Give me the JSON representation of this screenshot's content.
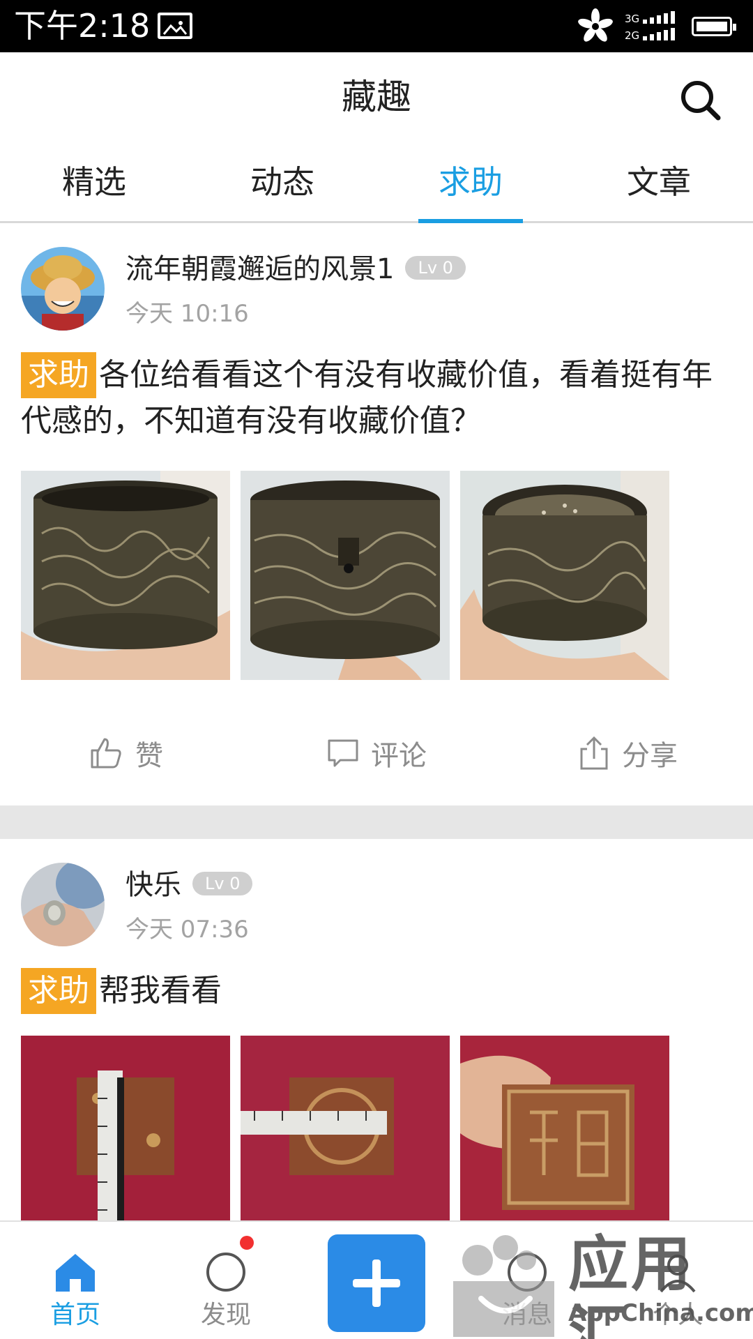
{
  "status_bar": {
    "time": "下午2:18",
    "network_top": "3G",
    "network_bottom": "2G"
  },
  "header": {
    "title": "藏趣",
    "search_icon": "search-icon"
  },
  "tabs": [
    {
      "label": "精选",
      "active": false
    },
    {
      "label": "动态",
      "active": false
    },
    {
      "label": "求助",
      "active": true
    },
    {
      "label": "文章",
      "active": false
    }
  ],
  "posts": [
    {
      "username": "流年朝霞邂逅的风景1",
      "level": "Lv 0",
      "time": "今天 10:16",
      "tag": "求助",
      "text": "各位给看看这个有没有收藏价值，看着挺有年代感的，不知道有没有收藏价值？"
    },
    {
      "username": "快乐",
      "level": "Lv 0",
      "time": "今天 07:36",
      "tag": "求助",
      "text": "帮我看看"
    }
  ],
  "actions": {
    "like": "赞",
    "comment": "评论",
    "share": "分享"
  },
  "bottom_nav": [
    {
      "label": "首页",
      "icon": "home-icon",
      "active": true
    },
    {
      "label": "发现",
      "icon": "discover-icon",
      "active": false
    },
    {
      "label": "",
      "icon": "add-icon",
      "active": false
    },
    {
      "label": "消息",
      "icon": "message-icon",
      "active": false
    },
    {
      "label": "个人",
      "icon": "profile-icon",
      "active": false
    }
  ],
  "watermark": {
    "main": "应用汇",
    "sub": "AppChina.com"
  },
  "colors": {
    "accent": "#1a9ee2",
    "help_tag": "#f5a623",
    "add_button": "#2b8be6",
    "badge_dot": "#f23030"
  }
}
